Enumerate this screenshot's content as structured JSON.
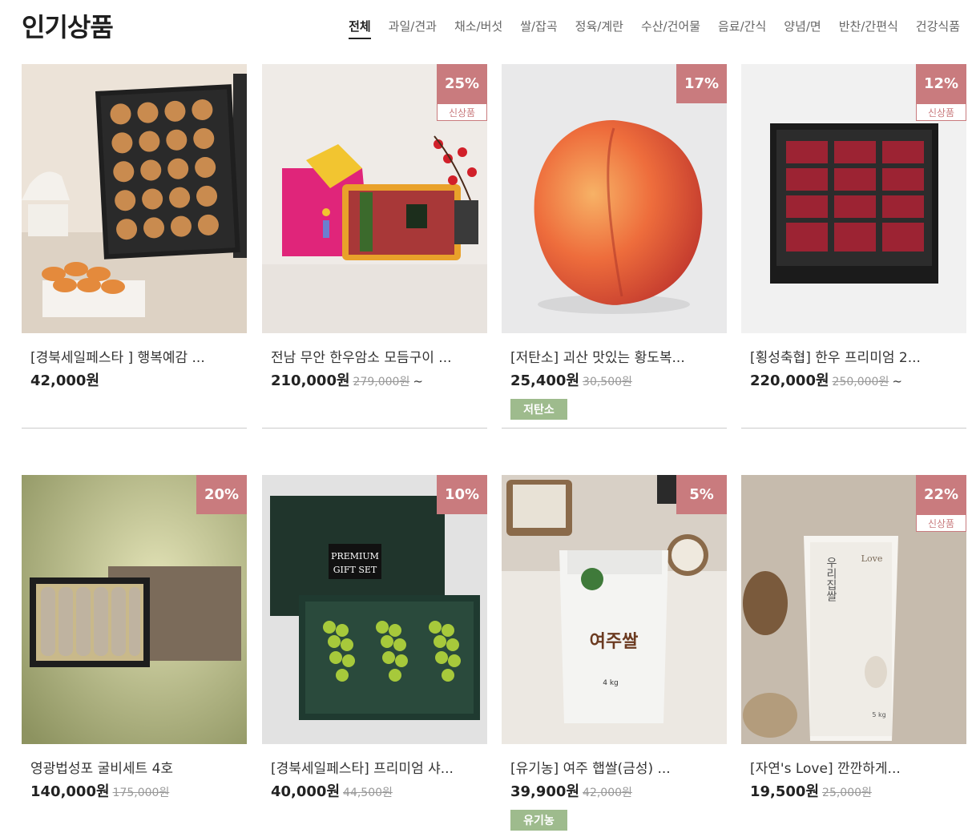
{
  "page_title": "인기상품",
  "tabs": [
    "전체",
    "과일/견과",
    "채소/버섯",
    "쌀/잡곡",
    "정육/계란",
    "수산/건어물",
    "음료/간식",
    "양념/면",
    "반찬/간편식",
    "건강식품"
  ],
  "active_tab": 0,
  "colors": {
    "discount_bg": "#c97b7e",
    "badge_bg": "#9ebb8d"
  },
  "products": [
    {
      "name": "[경북세일페스타 ] 행복예감 ...",
      "price": "42,000원",
      "original_price": "",
      "tilde": "",
      "discount": "",
      "new_tag": "",
      "badge": ""
    },
    {
      "name": "전남 무안 한우암소 모듬구이 ...",
      "price": "210,000원",
      "original_price": "279,000원",
      "tilde": "~",
      "discount": "25%",
      "new_tag": "신상품",
      "badge": ""
    },
    {
      "name": "[저탄소] 괴산 맛있는 황도복...",
      "price": "25,400원",
      "original_price": "30,500원",
      "tilde": "",
      "discount": "17%",
      "new_tag": "",
      "badge": "저탄소"
    },
    {
      "name": "[횡성축협] 한우 프리미엄 2...",
      "price": "220,000원",
      "original_price": "250,000원",
      "tilde": "~",
      "discount": "12%",
      "new_tag": "신상품",
      "badge": ""
    },
    {
      "name": "영광법성포 굴비세트 4호",
      "price": "140,000원",
      "original_price": "175,000원",
      "tilde": "",
      "discount": "20%",
      "new_tag": "",
      "badge": ""
    },
    {
      "name": "[경북세일페스타] 프리미엄 샤...",
      "price": "40,000원",
      "original_price": "44,500원",
      "tilde": "",
      "discount": "10%",
      "new_tag": "",
      "badge": ""
    },
    {
      "name": "[유기농] 여주 햅쌀(금성) ...",
      "price": "39,900원",
      "original_price": "42,000원",
      "tilde": "",
      "discount": "5%",
      "new_tag": "",
      "badge": "유기농"
    },
    {
      "name": "[자연's Love] 깐깐하게...",
      "price": "19,500원",
      "original_price": "25,000원",
      "tilde": "",
      "discount": "22%",
      "new_tag": "신상품",
      "badge": ""
    }
  ],
  "image_text": {
    "gift_box": "PREMIUM GIFT SET",
    "rice_bag_1": "여주쌀",
    "rice_bag_1_weight": "4 kg",
    "rice_bag_2": "우리집쌀",
    "rice_bag_2_brand": "Love",
    "rice_bag_2_weight": "5 kg"
  }
}
